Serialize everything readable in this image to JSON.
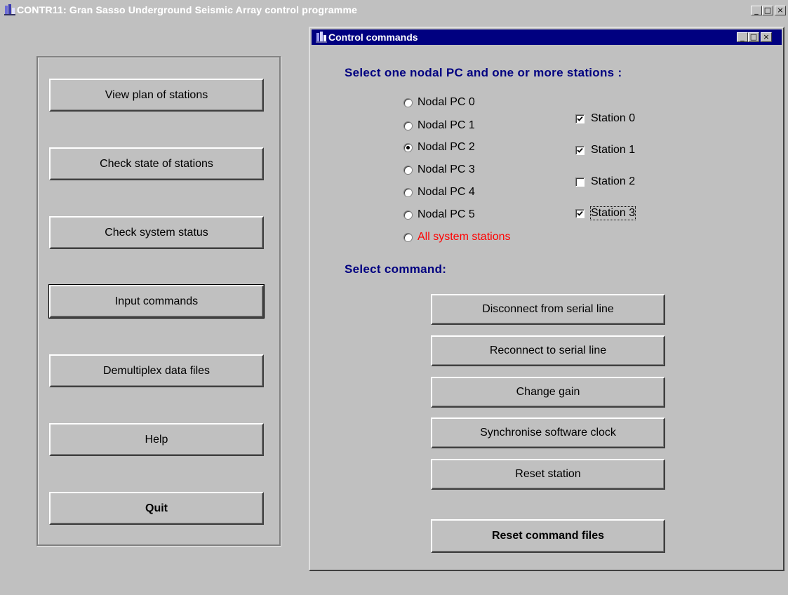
{
  "main_window": {
    "title": "CONTR11: Gran Sasso Underground Seismic Array control programme",
    "controls": {
      "minimize": "_",
      "maximize": "□",
      "close": "×"
    }
  },
  "left_panel": {
    "buttons": [
      {
        "label": "View plan of stations"
      },
      {
        "label": "Check state of stations"
      },
      {
        "label": "Check system status"
      },
      {
        "label": "Input commands"
      },
      {
        "label": "Demultiplex data files"
      },
      {
        "label": "Help"
      },
      {
        "label": "Quit"
      }
    ]
  },
  "dialog": {
    "title": "Control commands",
    "controls": {
      "minimize": "_",
      "maximize": "□",
      "close": "×"
    },
    "select_heading": "Select one nodal PC and one or more stations :",
    "nodal_pcs": [
      {
        "label": "Nodal PC 0",
        "checked": false
      },
      {
        "label": "Nodal PC 1",
        "checked": false
      },
      {
        "label": "Nodal PC 2",
        "checked": true
      },
      {
        "label": "Nodal PC 3",
        "checked": false
      },
      {
        "label": "Nodal PC 4",
        "checked": false
      },
      {
        "label": "Nodal PC 5",
        "checked": false
      },
      {
        "label": "All system stations",
        "checked": false
      }
    ],
    "stations": [
      {
        "label": "Station 0",
        "checked": true
      },
      {
        "label": "Station 1",
        "checked": true
      },
      {
        "label": "Station 2",
        "checked": false
      },
      {
        "label": "Station 3",
        "checked": true
      }
    ],
    "command_heading": "Select command:",
    "commands": [
      {
        "label": "Disconnect from serial line"
      },
      {
        "label": "Reconnect to serial line"
      },
      {
        "label": "Change gain"
      },
      {
        "label": "Synchronise software clock"
      },
      {
        "label": "Reset station"
      },
      {
        "label": "Reset command files"
      }
    ]
  },
  "colors": {
    "face": "#c0c0c0",
    "active_title": "#000080",
    "heading_text": "#000080",
    "warning_text": "#ff0000"
  }
}
